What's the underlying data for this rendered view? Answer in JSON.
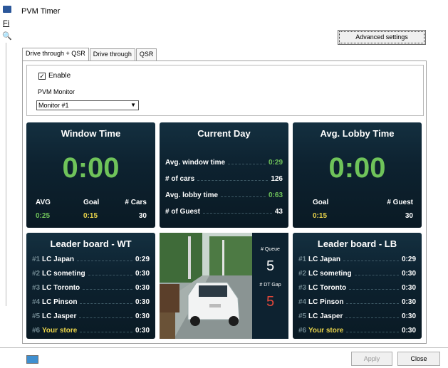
{
  "window": {
    "title": "PVM Timer"
  },
  "left_strip": {
    "menu_letter": "Fi"
  },
  "toolbar": {
    "advanced_label": "Advanced settings"
  },
  "tabs": [
    {
      "label": "Drive through + QSR",
      "active": true
    },
    {
      "label": "Drive through",
      "active": false
    },
    {
      "label": "QSR",
      "active": false
    }
  ],
  "settings": {
    "enable_label": "Enable",
    "enable_checked": true,
    "monitor_label": "PVM Monitor",
    "monitor_value": "Monitor #1"
  },
  "window_time": {
    "title": "Window Time",
    "big": "0:00",
    "avg_label": "AVG",
    "avg_value": "0:25",
    "goal_label": "Goal",
    "goal_value": "0:15",
    "cars_label": "# Cars",
    "cars_value": "30"
  },
  "current_day": {
    "title": "Current Day",
    "rows": [
      {
        "label": "Avg. window time",
        "value": "0:29",
        "color": "#6fc35a"
      },
      {
        "label": "# of cars",
        "value": "126",
        "color": "#ffffff"
      },
      {
        "label": "Avg. lobby time",
        "value": "0:63",
        "color": "#6fc35a"
      },
      {
        "label": "# of Guest",
        "value": "43",
        "color": "#ffffff"
      }
    ]
  },
  "lobby_time": {
    "title": "Avg. Lobby Time",
    "big": "0:00",
    "goal_label": "Goal",
    "goal_value": "0:15",
    "guest_label": "# Guest",
    "guest_value": "30"
  },
  "leader_wt": {
    "title": "Leader board - WT",
    "rows": [
      {
        "rank": "#1",
        "name": "LC Japan",
        "time": "0:29"
      },
      {
        "rank": "#2",
        "name": "LC someting",
        "time": "0:30"
      },
      {
        "rank": "#3",
        "name": "LC Toronto",
        "time": "0:30"
      },
      {
        "rank": "#4",
        "name": "LC Pinson",
        "time": "0:30"
      },
      {
        "rank": "#5",
        "name": "LC Jasper",
        "time": "0:30"
      },
      {
        "rank": "#6",
        "name": "Your store",
        "time": "0:30"
      }
    ]
  },
  "leader_lb": {
    "title": "Leader board - LB",
    "rows": [
      {
        "rank": "#1",
        "name": "LC Japan",
        "time": "0:29"
      },
      {
        "rank": "#2",
        "name": "LC someting",
        "time": "0:30"
      },
      {
        "rank": "#3",
        "name": "LC Toronto",
        "time": "0:30"
      },
      {
        "rank": "#4",
        "name": "LC Pinson",
        "time": "0:30"
      },
      {
        "rank": "#5",
        "name": "LC Jasper",
        "time": "0:30"
      },
      {
        "rank": "#6",
        "name": "Your store",
        "time": "0:30"
      }
    ]
  },
  "queue": {
    "queue_label": "# Queue",
    "queue_value": "5",
    "gap_label": "# DT Gap",
    "gap_value": "5"
  },
  "footer": {
    "apply_label": "Apply",
    "close_label": "Close"
  },
  "colors": {
    "panel": "#0d2230",
    "good": "#6fc35a",
    "goal": "#e9d34a",
    "alert": "#e0473a"
  }
}
